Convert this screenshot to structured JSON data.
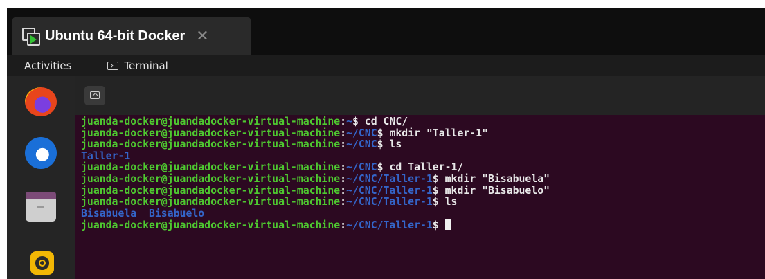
{
  "vm_tab": {
    "title": "Ubuntu 64-bit Docker",
    "close_glyph": "✕",
    "icon": "vm-play-icon"
  },
  "topbar": {
    "activities": "Activities",
    "app_name": "Terminal",
    "app_icon": "terminal-icon"
  },
  "dock": {
    "items": [
      {
        "name": "Firefox",
        "icon": "firefox-icon"
      },
      {
        "name": "Thunderbird",
        "icon": "thunderbird-icon"
      },
      {
        "name": "Files",
        "icon": "files-icon"
      },
      {
        "name": "Rhythmbox",
        "icon": "rhythmbox-icon"
      }
    ]
  },
  "terminal": {
    "colors": {
      "background": "#2c0921",
      "user": "#4ec830",
      "path": "#3465c9",
      "text": "#e8e8e8"
    },
    "lines": [
      {
        "user": "juanda-docker@juandadocker-virtual-machine",
        "sep": ":",
        "path": "~",
        "prompt": "$ ",
        "cmd": "cd CNC/"
      },
      {
        "user": "juanda-docker@juandadocker-virtual-machine",
        "sep": ":",
        "path": "~/CNC",
        "prompt": "$ ",
        "cmd": "mkdir \"Taller-1\""
      },
      {
        "user": "juanda-docker@juandadocker-virtual-machine",
        "sep": ":",
        "path": "~/CNC",
        "prompt": "$ ",
        "cmd": "ls"
      },
      {
        "output": "Taller-1"
      },
      {
        "user": "juanda-docker@juandadocker-virtual-machine",
        "sep": ":",
        "path": "~/CNC",
        "prompt": "$ ",
        "cmd": "cd Taller-1/"
      },
      {
        "user": "juanda-docker@juandadocker-virtual-machine",
        "sep": ":",
        "path": "~/CNC/Taller-1",
        "prompt": "$ ",
        "cmd": "mkdir \"Bisabuela\""
      },
      {
        "user": "juanda-docker@juandadocker-virtual-machine",
        "sep": ":",
        "path": "~/CNC/Taller-1",
        "prompt": "$ ",
        "cmd": "mkdir \"Bisabuelo\""
      },
      {
        "user": "juanda-docker@juandadocker-virtual-machine",
        "sep": ":",
        "path": "~/CNC/Taller-1",
        "prompt": "$ ",
        "cmd": "ls"
      },
      {
        "output": "Bisabuela  Bisabuelo"
      },
      {
        "user": "juanda-docker@juandadocker-virtual-machine",
        "sep": ":",
        "path": "~/CNC/Taller-1",
        "prompt": "$ ",
        "cmd": "",
        "cursor": true
      }
    ]
  }
}
